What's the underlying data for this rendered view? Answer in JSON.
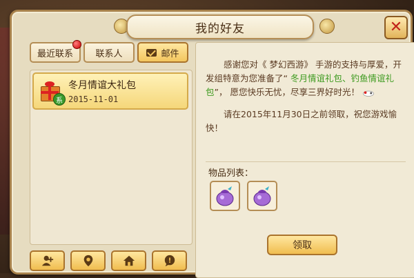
{
  "window": {
    "title": "我的好友"
  },
  "tabs": [
    {
      "label": "最近联系",
      "has_badge": true
    },
    {
      "label": "联系人",
      "has_badge": false
    },
    {
      "label": "邮件",
      "icon": "mail-icon",
      "active": true
    }
  ],
  "mail_list": [
    {
      "title": "冬月情谊大礼包",
      "date": "2015-11-01",
      "badge": "系",
      "icon": "gift-icon"
    }
  ],
  "bottom_buttons": [
    {
      "icon": "add-friend-icon"
    },
    {
      "icon": "location-icon"
    },
    {
      "icon": "home-icon"
    },
    {
      "icon": "chat-bubble-icon"
    }
  ],
  "message": {
    "line1_pre": "感谢您对《 梦幻西游》 手游的支持与厚爱，开发组特意为您准备了“ ",
    "line1_hl": "冬月情谊礼包、钓鱼情谊礼包",
    "line1_post": "”， 愿您快乐无忧，尽享三界好时光！",
    "line2": "请在2015年11月30日之前领取，祝您游戏愉快！"
  },
  "items": {
    "label": "物品列表：",
    "count": 2,
    "item_icon": "purple-pouch-icon"
  },
  "claim_button": {
    "label": "领取"
  },
  "colors": {
    "highlight": "#3c9a1e",
    "accent": "#f0bd4f",
    "close": "#c0211a"
  }
}
